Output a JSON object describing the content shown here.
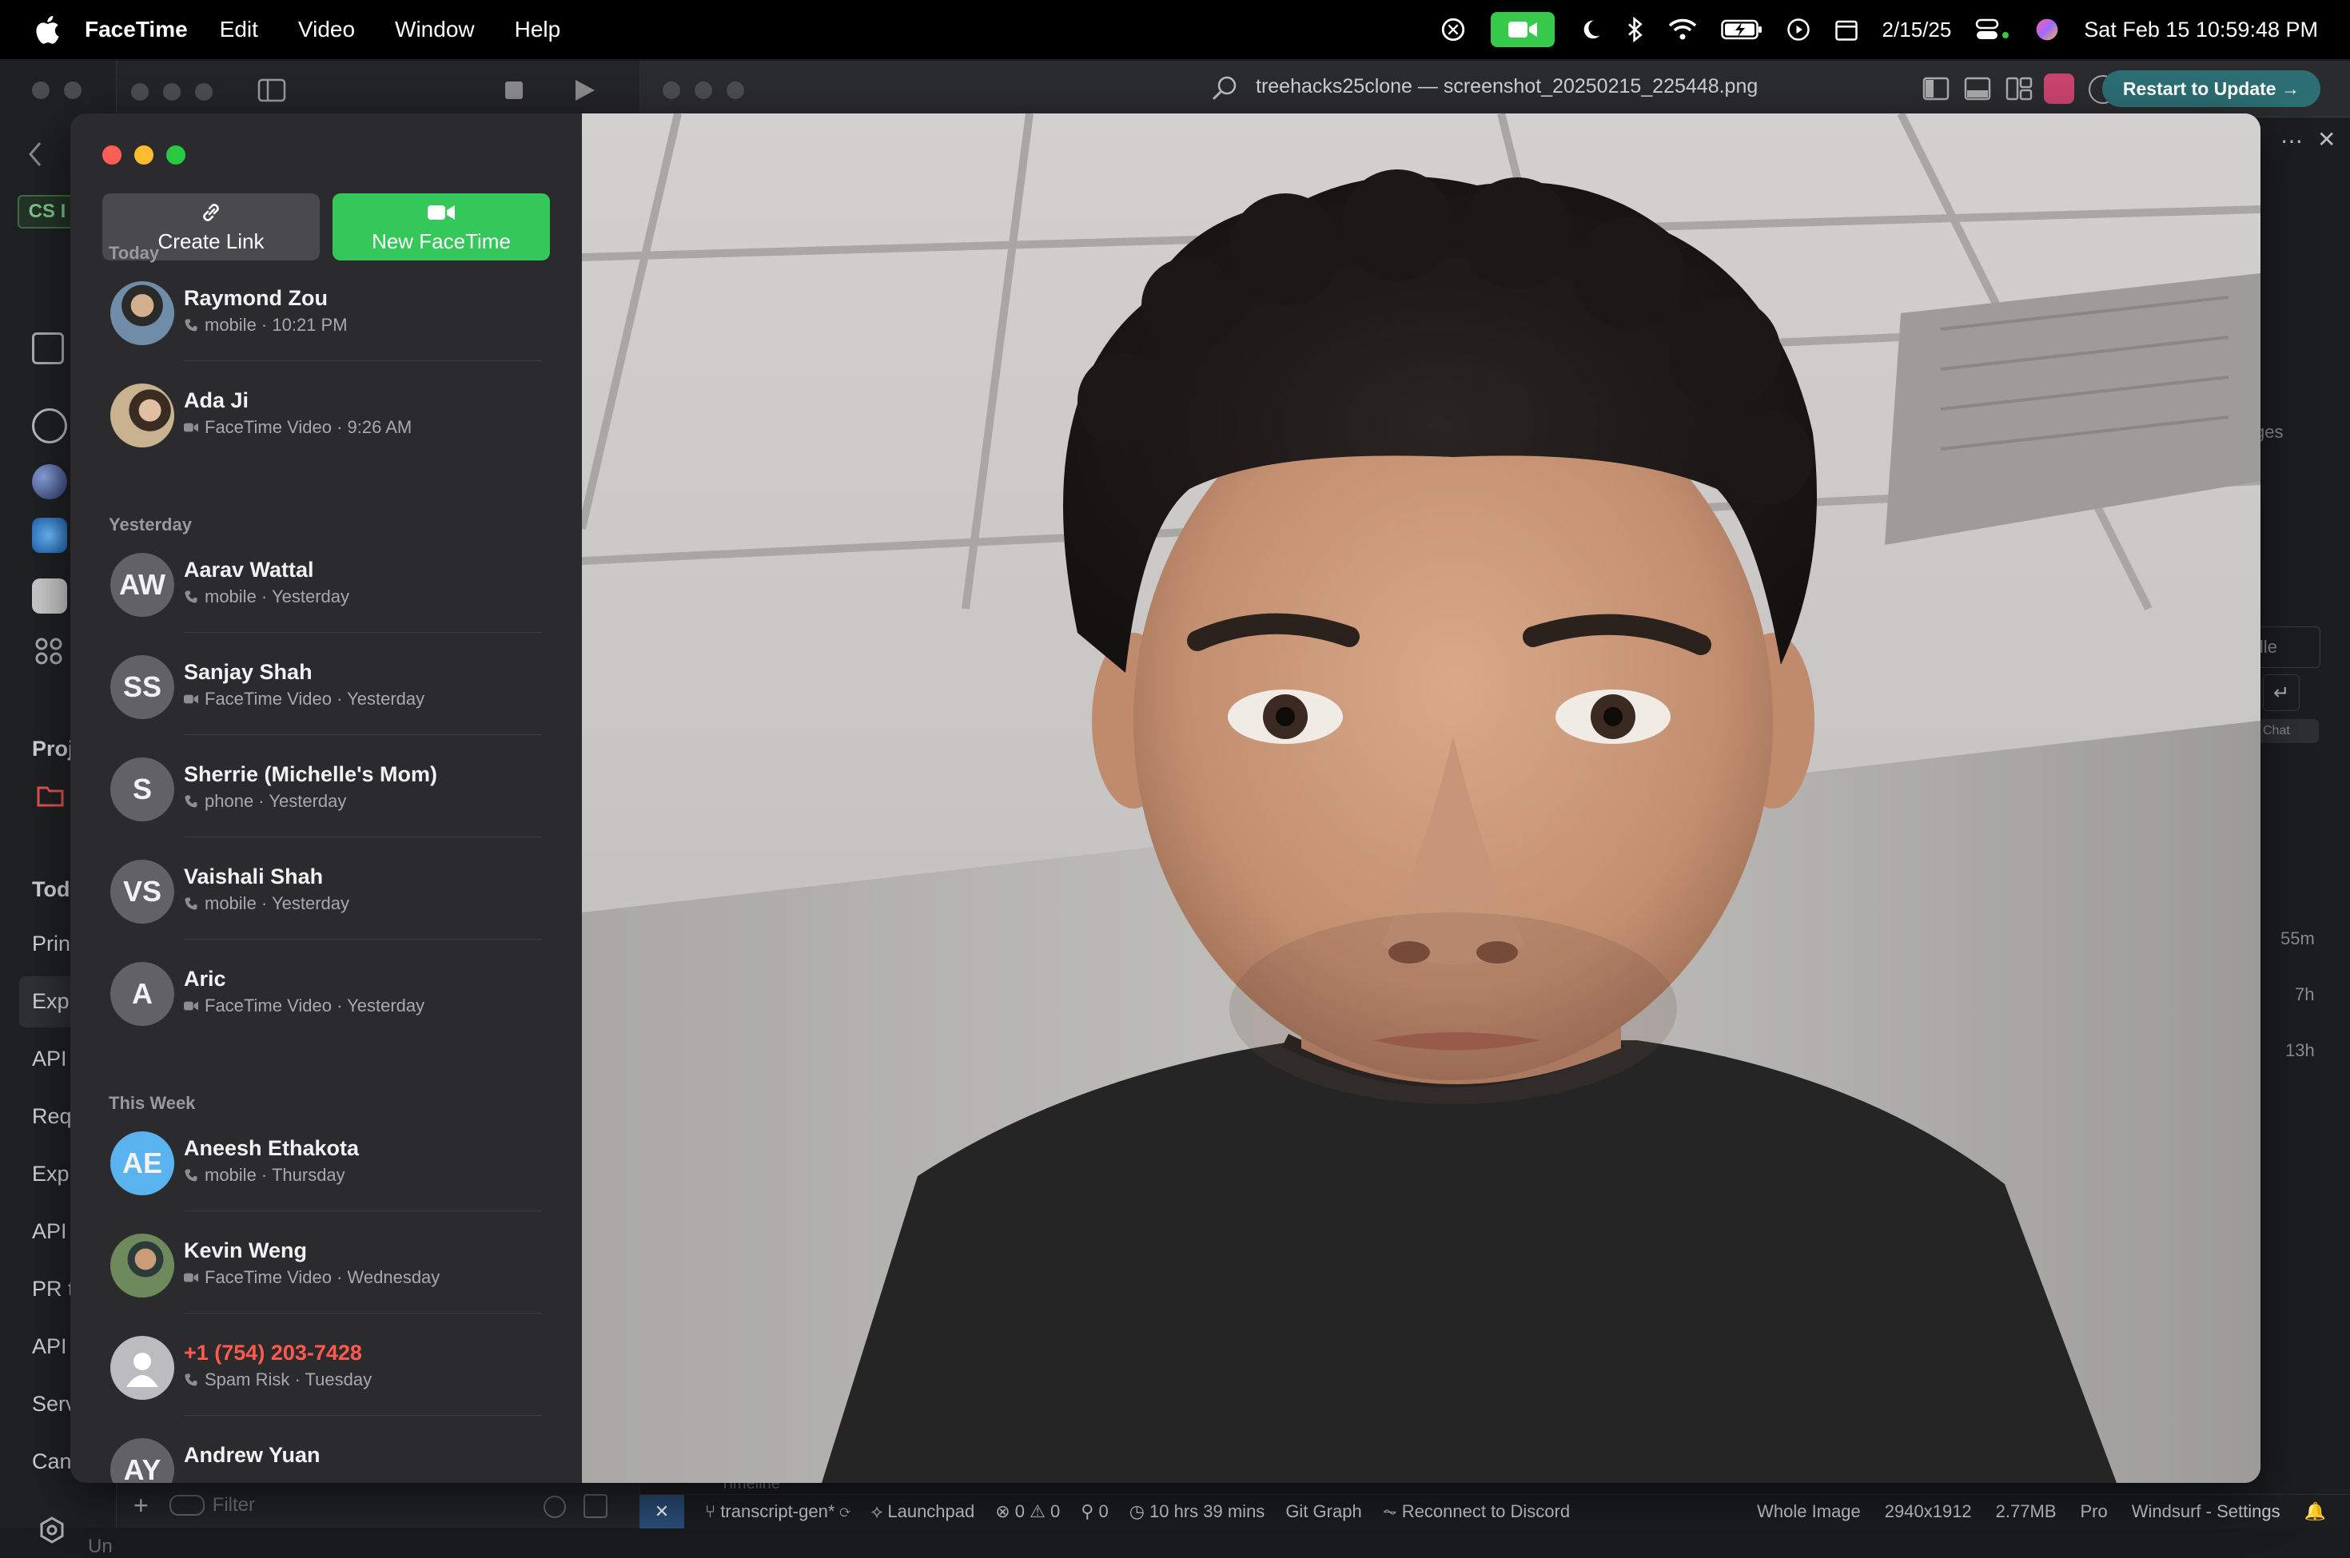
{
  "menubar": {
    "app_name": "FaceTime",
    "menus": [
      "Edit",
      "Video",
      "Window",
      "Help"
    ],
    "date_short": "2/15/25",
    "clock": "Sat Feb 15  10:59:48 PM"
  },
  "editor": {
    "title": "treehacks25clone — screenshot_20250215_225448.png",
    "restart_button": "Restart to Update →",
    "left_strip": [
      "CS I",
      "Proj",
      "Toda",
      "Prin",
      "Exp",
      "API",
      "Req",
      "Exp",
      "API",
      "PR t",
      "API",
      "Serv",
      "Can",
      "Un"
    ],
    "right_strip": [
      "ges",
      "ille",
      "Chat",
      "55m",
      "7h",
      "13h"
    ],
    "filter_placeholder": "Filter",
    "timeline_label": "Timeline",
    "statusbar": {
      "branch": "transcript-gen*",
      "launchpad": "Launchpad",
      "problems": "0 ⚠ 0",
      "ports": "0",
      "time": "10 hrs 39 mins",
      "git_graph": "Git Graph",
      "discord": "Reconnect to Discord",
      "whole_image": "Whole Image",
      "dimensions": "2940x1912",
      "filesize": "2.77MB",
      "plan": "Pro",
      "settings": "Windsurf - Settings"
    }
  },
  "facetime": {
    "create_link_label": "Create Link",
    "new_facetime_label": "New FaceTime",
    "sections": [
      {
        "title": "Today",
        "calls": [
          {
            "name": "Raymond Zou",
            "type": "phone",
            "detail": "mobile · 10:21 PM",
            "avatar": "photo1",
            "initials": ""
          },
          {
            "name": "Ada Ji",
            "type": "video",
            "detail": "FaceTime Video · 9:26 AM",
            "avatar": "photo2",
            "initials": ""
          }
        ]
      },
      {
        "title": "Yesterday",
        "calls": [
          {
            "name": "Aarav Wattal",
            "type": "phone",
            "detail": "mobile · Yesterday",
            "avatar": "gray",
            "initials": "AW"
          },
          {
            "name": "Sanjay Shah",
            "type": "video",
            "detail": "FaceTime Video · Yesterday",
            "avatar": "gray",
            "initials": "SS"
          },
          {
            "name": "Sherrie (Michelle's Mom)",
            "type": "phone",
            "detail": "phone · Yesterday",
            "avatar": "gray",
            "initials": "S"
          },
          {
            "name": "Vaishali Shah",
            "type": "phone",
            "detail": "mobile · Yesterday",
            "avatar": "gray",
            "initials": "VS"
          },
          {
            "name": "Aric",
            "type": "video",
            "detail": "FaceTime Video · Yesterday",
            "avatar": "gray",
            "initials": "A"
          }
        ]
      },
      {
        "title": "This Week",
        "calls": [
          {
            "name": "Aneesh Ethakota",
            "type": "phone",
            "detail": "mobile · Thursday",
            "avatar": "blue",
            "initials": "AE"
          },
          {
            "name": "Kevin Weng",
            "type": "video",
            "detail": "FaceTime Video · Wednesday",
            "avatar": "photo3",
            "initials": ""
          },
          {
            "name": "+1 (754) 203-7428",
            "type": "phone",
            "detail": "Spam Risk · Tuesday",
            "avatar": "generic",
            "initials": "",
            "spam": true
          },
          {
            "name": "Andrew Yuan",
            "type": "phone",
            "detail": "",
            "avatar": "gray",
            "initials": "AY"
          }
        ]
      }
    ]
  },
  "colors": {
    "facetime_green": "#34c759",
    "spam_red": "#ff5a4e",
    "avatar_blue": "#5ab2ee",
    "restart_teal": "#2c6e73"
  }
}
